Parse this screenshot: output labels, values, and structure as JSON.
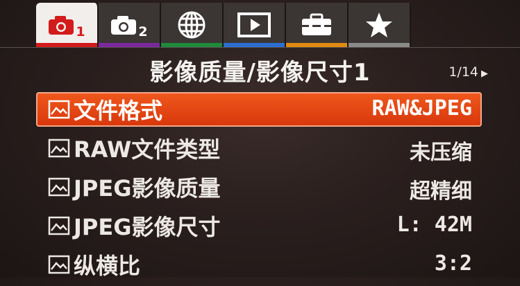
{
  "tabs": [
    {
      "name": "camera-settings-1",
      "icon": "camera-icon",
      "number": "1",
      "bar_color": "#d31b1b",
      "active": true
    },
    {
      "name": "camera-settings-2",
      "icon": "camera-icon",
      "number": "2",
      "bar_color": "#7a2a9c",
      "active": false
    },
    {
      "name": "network",
      "icon": "globe-icon",
      "number": "",
      "bar_color": "#1e8a3a",
      "active": false
    },
    {
      "name": "playback",
      "icon": "play-icon",
      "number": "",
      "bar_color": "#2d6fd0",
      "active": false
    },
    {
      "name": "setup",
      "icon": "toolbox-icon",
      "number": "",
      "bar_color": "#e08a12",
      "active": false
    },
    {
      "name": "my-menu",
      "icon": "star-icon",
      "number": "",
      "bar_color": "#8a8a8a",
      "active": false
    }
  ],
  "header": {
    "title": "影像质量/影像尺寸1",
    "page": "1/14"
  },
  "menu": {
    "items": [
      {
        "label": "文件格式",
        "value": "RAW&JPEG",
        "selected": true
      },
      {
        "label": "RAW文件类型",
        "value": "未压缩",
        "selected": false
      },
      {
        "label": "JPEG影像质量",
        "value": "超精细",
        "selected": false
      },
      {
        "label": "JPEG影像尺寸",
        "value": "L: 42M",
        "selected": false
      },
      {
        "label": "纵横比",
        "value": "3:2",
        "selected": false
      }
    ]
  },
  "colors": {
    "selected_bg": "#e2450f",
    "accent_red": "#d31b1b"
  }
}
